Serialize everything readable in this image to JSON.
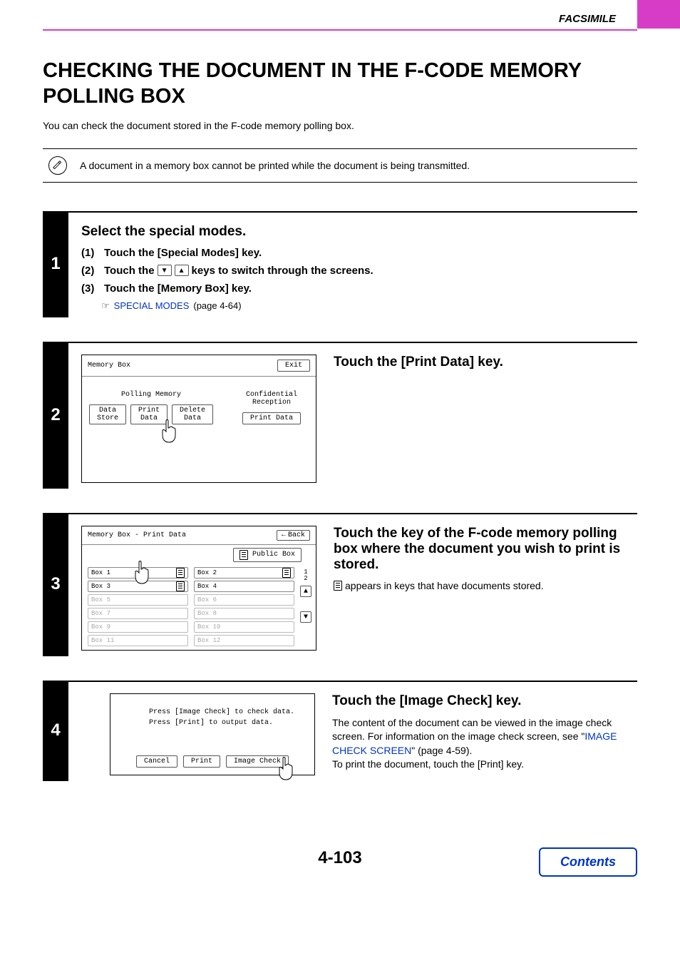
{
  "header": {
    "section": "FACSIMILE"
  },
  "title": "CHECKING THE DOCUMENT IN THE F-CODE MEMORY POLLING BOX",
  "intro": "You can check the document stored in the F-code memory polling box.",
  "note": "A document in a memory box cannot be printed while the document is being transmitted.",
  "step1": {
    "num": "1",
    "title": "Select the special modes.",
    "i1_num": "(1)",
    "i1_text": "Touch the [Special Modes] key.",
    "i2_num": "(2)",
    "i2_pre": "Touch the ",
    "i2_post": " keys to switch through the screens.",
    "i3_num": "(3)",
    "i3_text": "Touch the [Memory Box] key.",
    "ref_icon": "☞",
    "ref_link": "SPECIAL MODES",
    "ref_tail": " (page 4-64)"
  },
  "step2": {
    "num": "2",
    "title": "Touch the [Print Data] key.",
    "panel": {
      "title": "Memory Box",
      "exit": "Exit",
      "col1_label": "Polling Memory",
      "col2_label": "Confidential\nReception",
      "b_data_store": "Data Store",
      "b_print_data": "Print Data",
      "b_delete_data": "Delete Data",
      "b_conf_print": "Print Data"
    }
  },
  "step3": {
    "num": "3",
    "title": "Touch the key of the F-code memory polling box where the document you wish to print is stored.",
    "desc_tail": " appears in keys that have documents stored.",
    "panel": {
      "title": "Memory Box - Print Data",
      "back": "Back",
      "public": "Public Box",
      "pager": "1\n2",
      "boxes": [
        "Box 1",
        "Box 2",
        "Box 3",
        "Box 4",
        "Box 5",
        "Box 6",
        "Box 7",
        "Box 8",
        "Box 9",
        "Box 10",
        "Box 11",
        "Box 12"
      ]
    }
  },
  "step4": {
    "num": "4",
    "title": "Touch the [Image Check] key.",
    "p1": "The content of the document can be viewed in the image check screen. For information on the image check screen, see \"",
    "link": "IMAGE CHECK SCREEN",
    "p1_tail": "\" (page 4-59).",
    "p2": "To print the document, touch the [Print] key.",
    "panel": {
      "msg1": "Press [Image Check] to check data.",
      "msg2": "Press [Print] to output data.",
      "b_cancel": "Cancel",
      "b_print": "Print",
      "b_image_check": "Image Check"
    }
  },
  "footer": {
    "page": "4-103",
    "contents": "Contents"
  }
}
